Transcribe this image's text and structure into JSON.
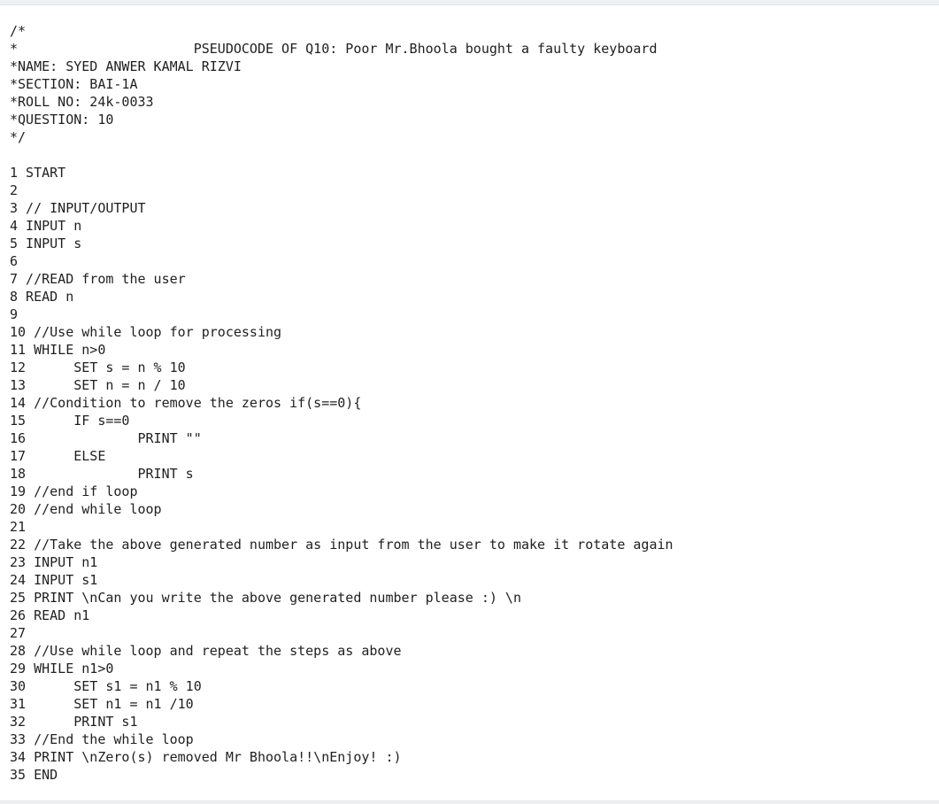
{
  "document": {
    "lines": [
      "/*",
      "*                      PSEUDOCODE OF Q10: Poor Mr.Bhoola bought a faulty keyboard",
      "*NAME: SYED ANWER KAMAL RIZVI",
      "*SECTION: BAI-1A",
      "*ROLL NO: 24k-0033",
      "*QUESTION: 10",
      "*/",
      "",
      "1 START",
      "2",
      "3 // INPUT/OUTPUT",
      "4 INPUT n",
      "5 INPUT s",
      "6",
      "7 //READ from the user",
      "8 READ n",
      "9",
      "10 //Use while loop for processing",
      "11 WHILE n>0",
      "12      SET s = n % 10",
      "13      SET n = n / 10",
      "14 //Condition to remove the zeros if(s==0){",
      "15      IF s==0",
      "16              PRINT \"\"",
      "17      ELSE",
      "18              PRINT s",
      "19 //end if loop",
      "20 //end while loop",
      "21",
      "22 //Take the above generated number as input from the user to make it rotate again",
      "23 INPUT n1",
      "24 INPUT s1",
      "25 PRINT \\nCan you write the above generated number please :) \\n",
      "26 READ n1",
      "27",
      "28 //Use while loop and repeat the steps as above",
      "29 WHILE n1>0",
      "30      SET s1 = n1 % 10",
      "31      SET n1 = n1 /10",
      "32      PRINT s1",
      "33 //End the while loop",
      "34 PRINT \\nZero(s) removed Mr Bhoola!!\\nEnjoy! :)",
      "35 END"
    ]
  }
}
